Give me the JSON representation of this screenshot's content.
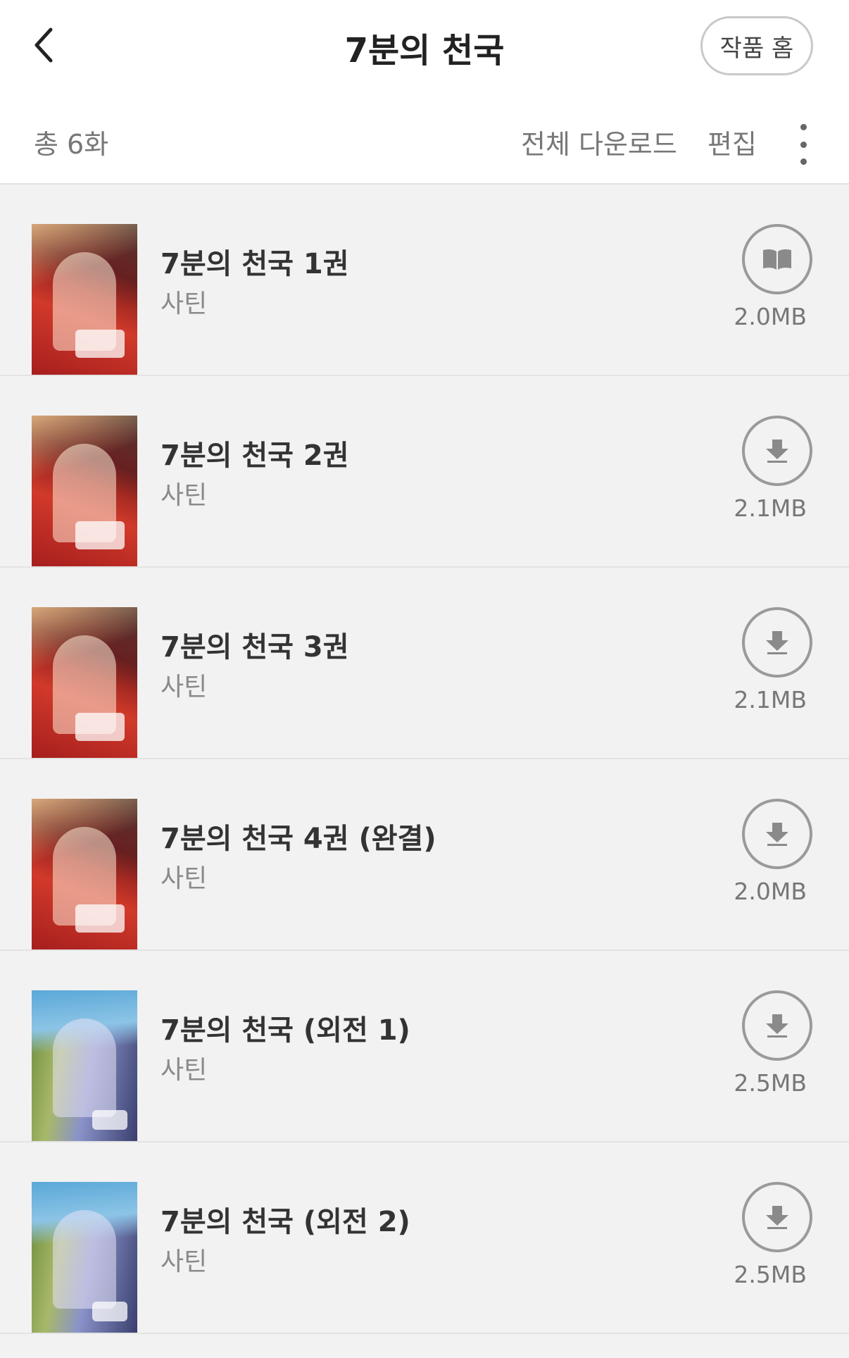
{
  "header": {
    "title": "7분의 천국",
    "home_button": "작품 홈",
    "back_icon": "chevron-left-icon"
  },
  "toolbar": {
    "total_label": "총 6화",
    "download_all_label": "전체 다운로드",
    "edit_label": "편집",
    "more_icon": "vertical-dots-icon"
  },
  "episodes": [
    {
      "title": "7분의 천국 1권",
      "author": "사틴",
      "size": "2.0MB",
      "state": "downloaded",
      "icon": "book-open-icon",
      "cover": "red"
    },
    {
      "title": "7분의 천국 2권",
      "author": "사틴",
      "size": "2.1MB",
      "state": "not-downloaded",
      "icon": "download-arrow-icon",
      "cover": "red"
    },
    {
      "title": "7분의 천국 3권",
      "author": "사틴",
      "size": "2.1MB",
      "state": "not-downloaded",
      "icon": "download-arrow-icon",
      "cover": "red"
    },
    {
      "title": "7분의 천국 4권 (완결)",
      "author": "사틴",
      "size": "2.0MB",
      "state": "not-downloaded",
      "icon": "download-arrow-icon",
      "cover": "red"
    },
    {
      "title": "7분의 천국 (외전 1)",
      "author": "사틴",
      "size": "2.5MB",
      "state": "not-downloaded",
      "icon": "download-arrow-icon",
      "cover": "blue"
    },
    {
      "title": "7분의 천국 (외전 2)",
      "author": "사틴",
      "size": "2.5MB",
      "state": "not-downloaded",
      "icon": "download-arrow-icon",
      "cover": "blue"
    }
  ],
  "colors": {
    "background": "#f2f2f2",
    "header_background": "#ffffff",
    "icon_gray": "#8a8a8a"
  }
}
